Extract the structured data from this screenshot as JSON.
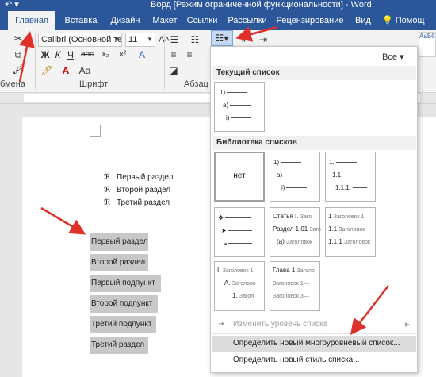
{
  "window": {
    "title": "Ворд [Режим ограниченной функциональности] - Word",
    "undo_icon": "undo-icon",
    "accent": "#2b579a"
  },
  "tabs": [
    {
      "label": "Главная",
      "active": true
    },
    {
      "label": "Вставка"
    },
    {
      "label": "Дизайн"
    },
    {
      "label": "Макет"
    },
    {
      "label": "Ссылки"
    },
    {
      "label": "Рассылки"
    },
    {
      "label": "Рецензирование"
    },
    {
      "label": "Вид"
    }
  ],
  "help": {
    "icon": "lightbulb-icon",
    "label": "Помощ"
  },
  "ribbon": {
    "font_name": "Calibri (Основной тек",
    "font_size": "11",
    "bold": "Ж",
    "italic": "К",
    "underline": "Ч",
    "strike": "abc",
    "subscript": "x₂",
    "clipboard_label": "бмена",
    "font_group_label": "Шрифт",
    "para_group_label": "Абзац",
    "style_sample": "АаБбВ"
  },
  "document": {
    "bullet_symbol": "ℜ",
    "bullets": [
      "Первый раздел",
      "Второй раздел",
      "Третий раздел"
    ],
    "highlighted": [
      "Первый раздел",
      "Второй раздел",
      "Первый подпункт",
      "Второй подпункт",
      "Третий подпункт",
      "Третий раздел"
    ]
  },
  "panel": {
    "filter": "Все ▾",
    "current_header": "Текущий список",
    "library_header": "Библиотека списков",
    "none_label": "нет",
    "current_list": [
      "1)",
      "a)",
      "i)"
    ],
    "lib_lists": {
      "paren": [
        "1)",
        "a)",
        "i)"
      ],
      "decimal": [
        "1.",
        "1.1.",
        "1.1.1."
      ],
      "arrows": [
        "❖",
        "➤",
        "■"
      ],
      "article": [
        "Статья I.",
        "Заго",
        "Раздел 1.01",
        "Заго",
        "(a)",
        "Заголовок"
      ],
      "heading1": [
        "1",
        "Заголовок 1—",
        "1.1",
        "Заголовок",
        "1.1.1",
        "Заголовок"
      ],
      "roman": [
        "I.",
        "Заголовок 1—",
        "A.",
        "Заголово",
        "1.",
        "Загол"
      ],
      "chapter": [
        "Глава 1",
        "Заголо",
        "Заголовок 1—",
        "Заголовок 3—"
      ]
    },
    "menu": {
      "change_level": "Изменить уровень списка",
      "define_multilevel": "Определить новый многоуровневый список...",
      "define_style": "Определить новый стиль списка..."
    }
  }
}
